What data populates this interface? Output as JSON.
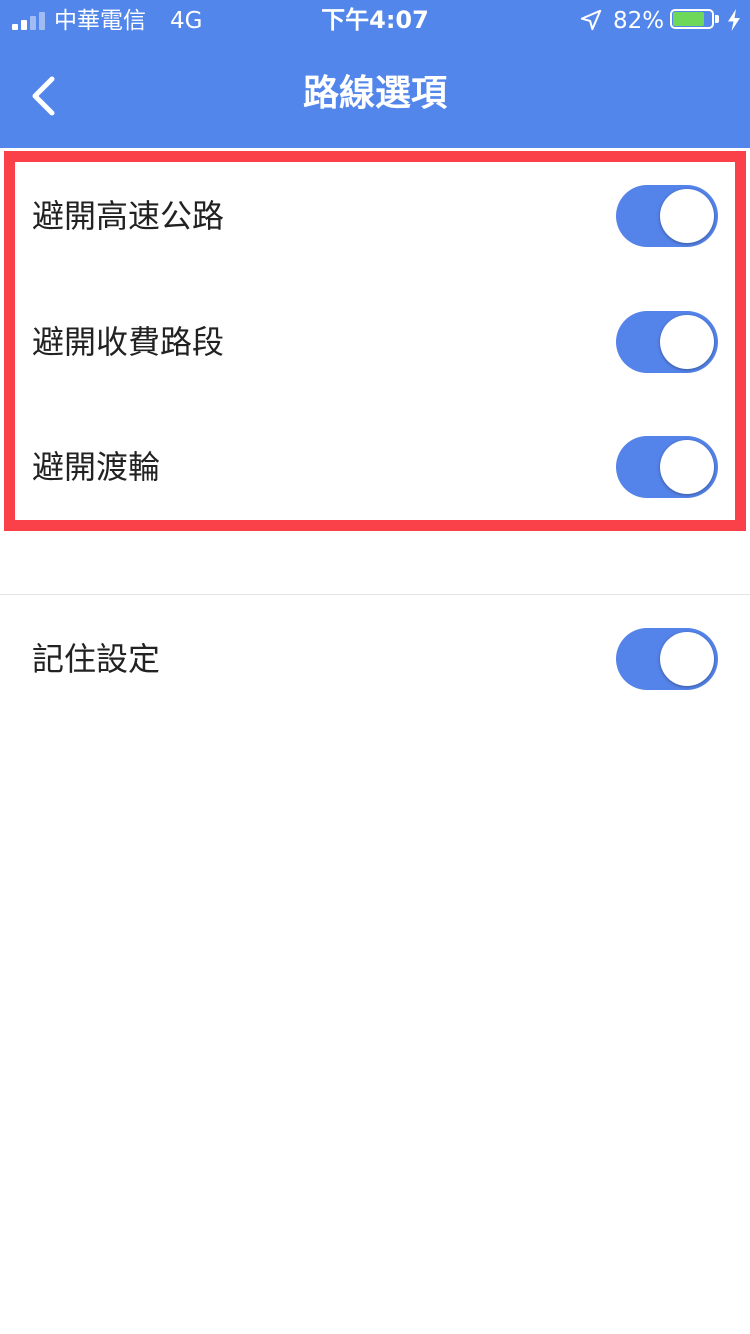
{
  "status_bar": {
    "carrier": "中華電信",
    "network": "4G",
    "time": "下午4:07",
    "battery_percent": "82%",
    "battery_level": 0.82,
    "battery_fill_color": "#6ed85b",
    "signal_bars_active": 2,
    "signal_bars_total": 4,
    "icons": [
      "signal-icon",
      "location-arrow-icon",
      "battery-icon",
      "charging-bolt-icon"
    ]
  },
  "nav": {
    "back_icon": "chevron-left-icon",
    "title": "路線選項"
  },
  "route_options": [
    {
      "label": "避開高速公路",
      "enabled": true
    },
    {
      "label": "避開收費路段",
      "enabled": true
    },
    {
      "label": "避開渡輪",
      "enabled": true
    }
  ],
  "remember_settings": {
    "label": "記住設定",
    "enabled": true
  },
  "colors": {
    "header_background": "#5286ea",
    "toggle_on": "#5483e9",
    "highlight_border": "#fa414a",
    "text": "#222222"
  }
}
